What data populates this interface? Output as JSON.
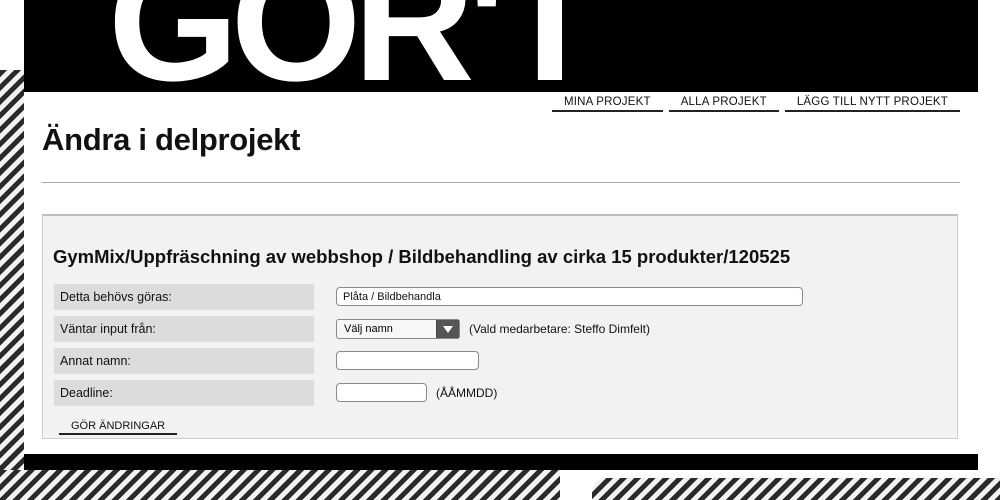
{
  "header": {
    "logo_text": "GÖR'T"
  },
  "topnav": {
    "items": [
      {
        "label": "MINA PROJEKT"
      },
      {
        "label": "ALLA PROJEKT"
      },
      {
        "label": "LÄGG TILL NYTT PROJEKT"
      }
    ]
  },
  "page": {
    "title": "Ändra i delprojekt"
  },
  "form": {
    "heading": "GymMix/Uppfräschning av webbshop / Bildbehandling av cirka 15 produkter/120525",
    "rows": {
      "todo": {
        "label": "Detta behövs göras:",
        "value": "Plåta / Bildbehandla"
      },
      "waiting": {
        "label": "Väntar input från:",
        "selected": "Välj namn",
        "note": "(Vald medarbetare: Steffo Dimfelt)"
      },
      "other_name": {
        "label": "Annat namn:",
        "value": ""
      },
      "deadline": {
        "label": "Deadline:",
        "value": "",
        "hint": "(ÅÅMMDD)"
      }
    },
    "submit_label": "GÖR ÄNDRINGAR"
  },
  "colors": {
    "frame": "#000000",
    "label_bg": "#dcdcdc",
    "panel_bg": "#f2f2f2"
  }
}
